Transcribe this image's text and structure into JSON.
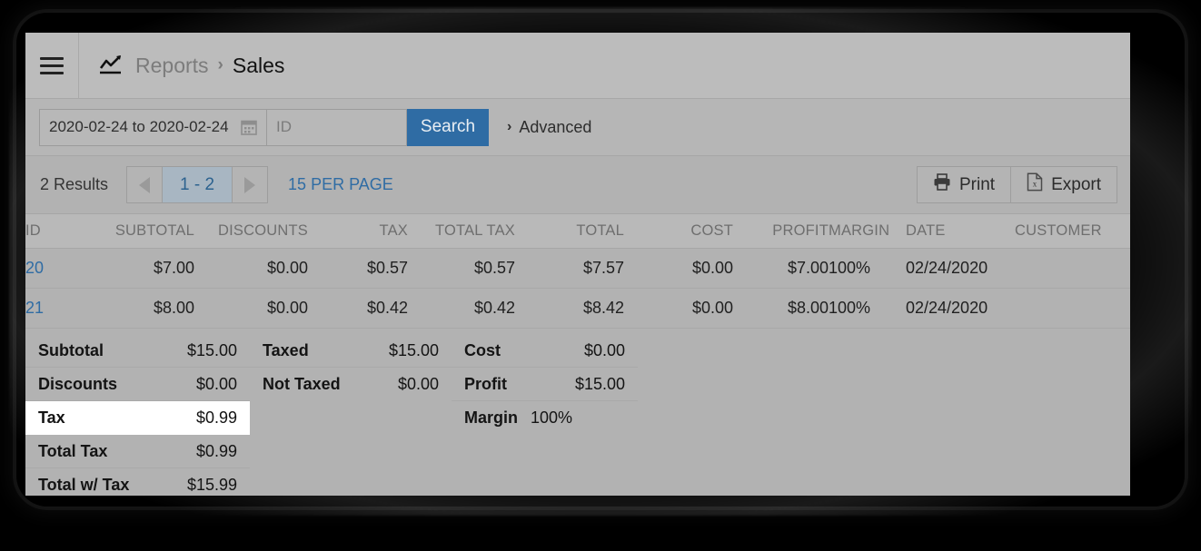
{
  "window": {
    "menu_icon": "hamburger-icon",
    "breadcrumb": {
      "icon": "chart-line-icon",
      "root": "Reports",
      "separator": "›",
      "current": "Sales"
    }
  },
  "search": {
    "date_range_value": "2020-02-24 to 2020-02-24",
    "calendar_icon": "calendar-icon",
    "id_placeholder": "ID",
    "id_value": "",
    "search_label": "Search",
    "advanced_label": "Advanced",
    "advanced_chevron": "›"
  },
  "toolbar": {
    "results_count": "2 Results",
    "prev_icon": "chevron-left-icon",
    "next_icon": "chevron-right-icon",
    "page_range": "1 - 2",
    "per_page_label": "15 PER PAGE",
    "print_label": "Print",
    "print_icon": "printer-icon",
    "export_label": "Export",
    "export_icon": "excel-file-icon"
  },
  "table": {
    "columns": [
      "ID",
      "SUBTOTAL",
      "DISCOUNTS",
      "TAX",
      "TOTAL TAX",
      "TOTAL",
      "COST",
      "PROFIT",
      "MARGIN",
      "DATE",
      "CUSTOMER"
    ],
    "rows": [
      {
        "id": "20",
        "subtotal": "$7.00",
        "discounts": "$0.00",
        "tax": "$0.57",
        "total_tax": "$0.57",
        "total": "$7.57",
        "cost": "$0.00",
        "profit": "$7.00",
        "margin": "100%",
        "date": "02/24/2020",
        "customer": ""
      },
      {
        "id": "21",
        "subtotal": "$8.00",
        "discounts": "$0.00",
        "tax": "$0.42",
        "total_tax": "$0.42",
        "total": "$8.42",
        "cost": "$0.00",
        "profit": "$8.00",
        "margin": "100%",
        "date": "02/24/2020",
        "customer": ""
      }
    ]
  },
  "summary": {
    "column1": [
      {
        "label": "Subtotal",
        "value": "$15.00"
      },
      {
        "label": "Discounts",
        "value": "$0.00"
      },
      {
        "label": "Tax",
        "value": "$0.99"
      },
      {
        "label": "Total Tax",
        "value": "$0.99"
      },
      {
        "label": "Total w/ Tax",
        "value": "$15.99"
      }
    ],
    "column2": [
      {
        "label": "Taxed",
        "value": "$15.00"
      },
      {
        "label": "Not Taxed",
        "value": "$0.00"
      }
    ],
    "column3": [
      {
        "label": "Cost",
        "value": "$0.00"
      },
      {
        "label": "Profit",
        "value": "$15.00"
      },
      {
        "label": "Margin",
        "value": "100%"
      }
    ],
    "highlighted_row_label": "Tax"
  },
  "colors": {
    "accent_blue": "#2f6ca4",
    "panel_bg": "#b2b2b2",
    "header_bg": "#bcbcbc",
    "highlight_bg": "#ffffff"
  }
}
